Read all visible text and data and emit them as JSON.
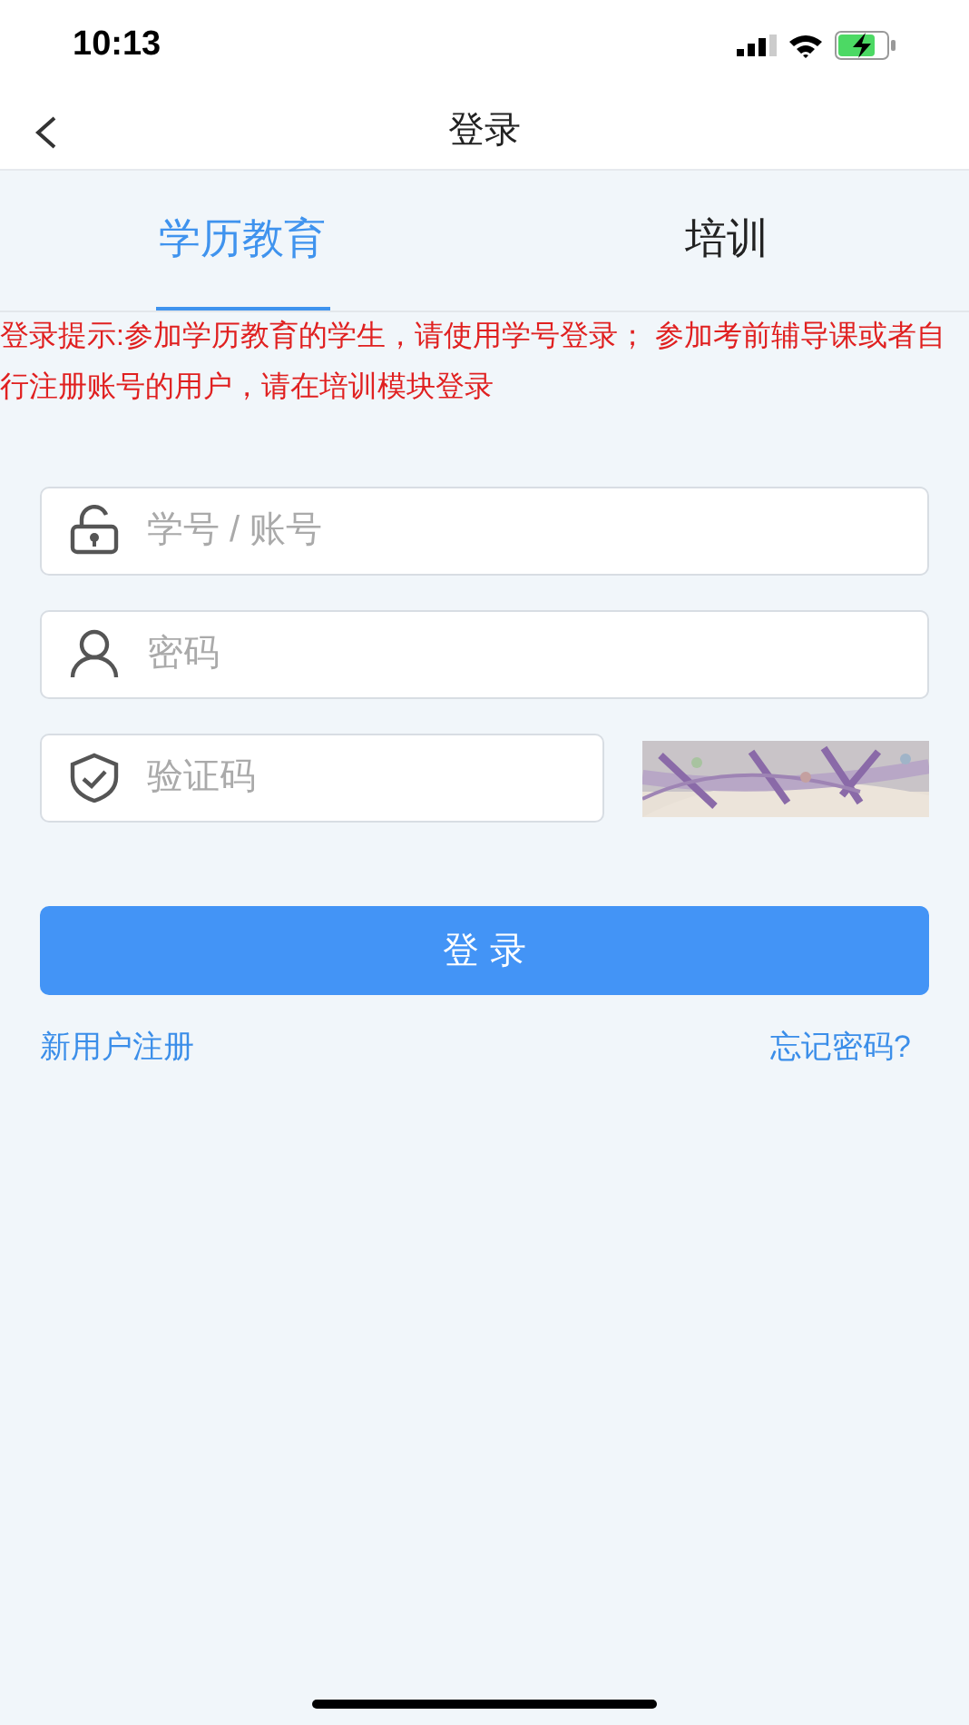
{
  "status_bar": {
    "time": "10:13"
  },
  "nav": {
    "title": "登录"
  },
  "tabs": [
    {
      "label": "学历教育",
      "selected": true
    },
    {
      "label": "培训",
      "selected": false
    }
  ],
  "notice": "登录提示:参加学历教育的学生，请使用学号登录； 参加考前辅导课或者自行注册账号的用户，请在培训模块登录",
  "fields": [
    {
      "kind": "account",
      "placeholder": "学号 / 账号"
    },
    {
      "kind": "password",
      "placeholder": "密码"
    },
    {
      "kind": "captcha",
      "placeholder": "验证码"
    }
  ],
  "login_button": "登 录",
  "links": {
    "register": "新用户注册",
    "forgot": "忘记密码?"
  }
}
